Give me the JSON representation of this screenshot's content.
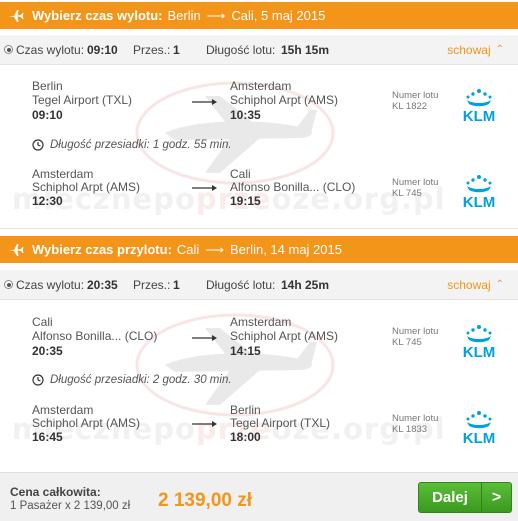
{
  "outbound": {
    "header": {
      "title": "Wybierz czas wylotu:",
      "from": "Berlin",
      "to": "Cali, 5 maj 2015"
    },
    "summary": {
      "depart_label": "Czas wylotu:",
      "depart_time": "09:10",
      "stops_label": "Przes.:",
      "stops": "1",
      "duration_label": "Długość lotu:",
      "duration": "15h 15m",
      "toggle": "schowaj"
    },
    "segments": [
      {
        "from_city": "Berlin",
        "from_airport": "Tegel Airport (TXL)",
        "from_time": "09:10",
        "to_city": "Amsterdam",
        "to_airport": "Schiphol Arpt (AMS)",
        "to_time": "10:35",
        "flight_label": "Numer lotu",
        "flight_no": "KL 1822",
        "airline": "KLM"
      },
      {
        "from_city": "Amsterdam",
        "from_airport": "Schiphol Arpt (AMS)",
        "from_time": "12:30",
        "to_city": "Cali",
        "to_airport": "Alfonso Bonilla... (CLO)",
        "to_time": "19:15",
        "flight_label": "Numer lotu",
        "flight_no": "KL 745",
        "airline": "KLM"
      }
    ],
    "layover": "Długość przesiadki: 1 godz. 55 min."
  },
  "return": {
    "header": {
      "title": "Wybierz czas przylotu:",
      "from": "Cali",
      "to": "Berlin, 14 maj 2015"
    },
    "summary": {
      "depart_label": "Czas wylotu:",
      "depart_time": "20:35",
      "stops_label": "Przes.:",
      "stops": "1",
      "duration_label": "Długość lotu:",
      "duration": "14h 25m",
      "toggle": "schowaj"
    },
    "segments": [
      {
        "from_city": "Cali",
        "from_airport": "Alfonso Bonilla... (CLO)",
        "from_time": "20:35",
        "to_city": "Amsterdam",
        "to_airport": "Schiphol Arpt (AMS)",
        "to_time": "14:15",
        "flight_label": "Numer lotu",
        "flight_no": "KL 745",
        "airline": "KLM"
      },
      {
        "from_city": "Amsterdam",
        "from_airport": "Schiphol Arpt (AMS)",
        "from_time": "16:45",
        "to_city": "Berlin",
        "to_airport": "Tegel Airport (TXL)",
        "to_time": "18:00",
        "flight_label": "Numer lotu",
        "flight_no": "KL 1833",
        "airline": "KLM"
      }
    ],
    "layover": "Długość przesiadki: 2 godz. 30 min."
  },
  "watermark": {
    "left": "mlecznepo",
    "mid": "prze",
    "right": "oze.org.pl"
  },
  "footer": {
    "total_label": "Cena całkowita:",
    "passenger_line": "1 Pasażer   x   2 139,00 zł",
    "price": "2 139,00 zł",
    "next_button": "Dalej",
    "next_arrow": ">"
  },
  "colors": {
    "accent": "#f39519",
    "klm_blue": "#00a1de",
    "button_green": "#4aac2b"
  }
}
